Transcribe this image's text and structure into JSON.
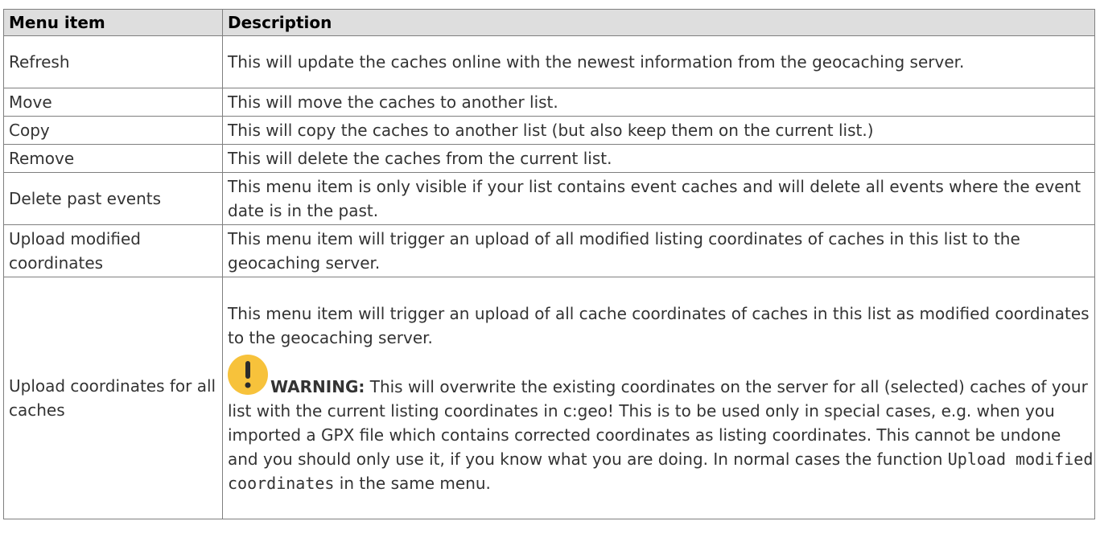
{
  "table": {
    "headers": [
      "Menu item",
      "Description"
    ],
    "rows": [
      {
        "item": "Refresh",
        "description": "This will update the caches online with the newest information from the geocaching server."
      },
      {
        "item": "Move",
        "description": "This will move the caches to another list."
      },
      {
        "item": "Copy",
        "description": "This will copy the caches to another list (but also keep them on the current list.)"
      },
      {
        "item": "Remove",
        "description": "This will delete the caches from the current list."
      },
      {
        "item": "Delete past events",
        "description": "This menu item is only visible if your list contains event caches and will delete all events where the event date is in the past."
      },
      {
        "item": "Upload modified coordinates",
        "description": "This menu item will trigger an upload of all modified listing coordinates of caches in this list to the geocaching server."
      },
      {
        "item": "Upload coordinates for all caches",
        "description": "This menu item will trigger an upload of all cache coordinates of caches in this list as modified coordinates to the geocaching server.",
        "warning": {
          "icon": "exclamation-warning-icon",
          "label": "WARNING:",
          "text": " This will overwrite the existing coordinates on the server for all (selected) caches of your list with the current listing coordinates in c:geo! This is to be used only in special cases, e.g. when you imported a GPX file which contains corrected coordinates as listing coordinates. This cannot be undone and you should only use it, if you know what you are doing. In normal cases the function ",
          "code": "Upload modified coordinates",
          "suffix": " in the same menu."
        }
      }
    ]
  },
  "colors": {
    "header_bg": "#dedede",
    "border": "#7f7f7f",
    "warning_icon": "#f7c23b"
  }
}
